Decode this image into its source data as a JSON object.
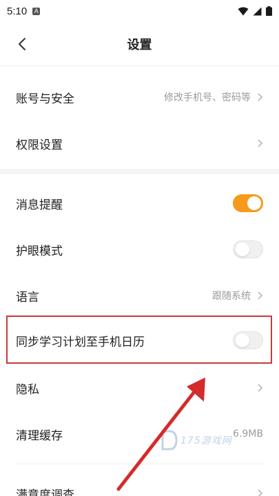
{
  "status_bar": {
    "time": "5:10",
    "notification_letter": "A"
  },
  "header": {
    "title": "设置"
  },
  "rows": {
    "account": {
      "label": "账号与安全",
      "value": "修改手机号、密码等"
    },
    "permissions": {
      "label": "权限设置"
    },
    "notifications": {
      "label": "消息提醒",
      "toggle": "on"
    },
    "eye_care": {
      "label": "护眼模式",
      "toggle": "off"
    },
    "language": {
      "label": "语言",
      "value": "跟随系统"
    },
    "calendar_sync": {
      "label": "同步学习计划至手机日历",
      "toggle": "off"
    },
    "privacy": {
      "label": "隐私"
    },
    "cache": {
      "label": "清理缓存",
      "value": "6.9MB"
    },
    "survey": {
      "label": "满意度调查"
    }
  },
  "colors": {
    "accent": "#f59a1b",
    "highlight": "#c9383b",
    "arrow": "#d42b2b"
  },
  "watermark": {
    "text": "175游戏网"
  }
}
